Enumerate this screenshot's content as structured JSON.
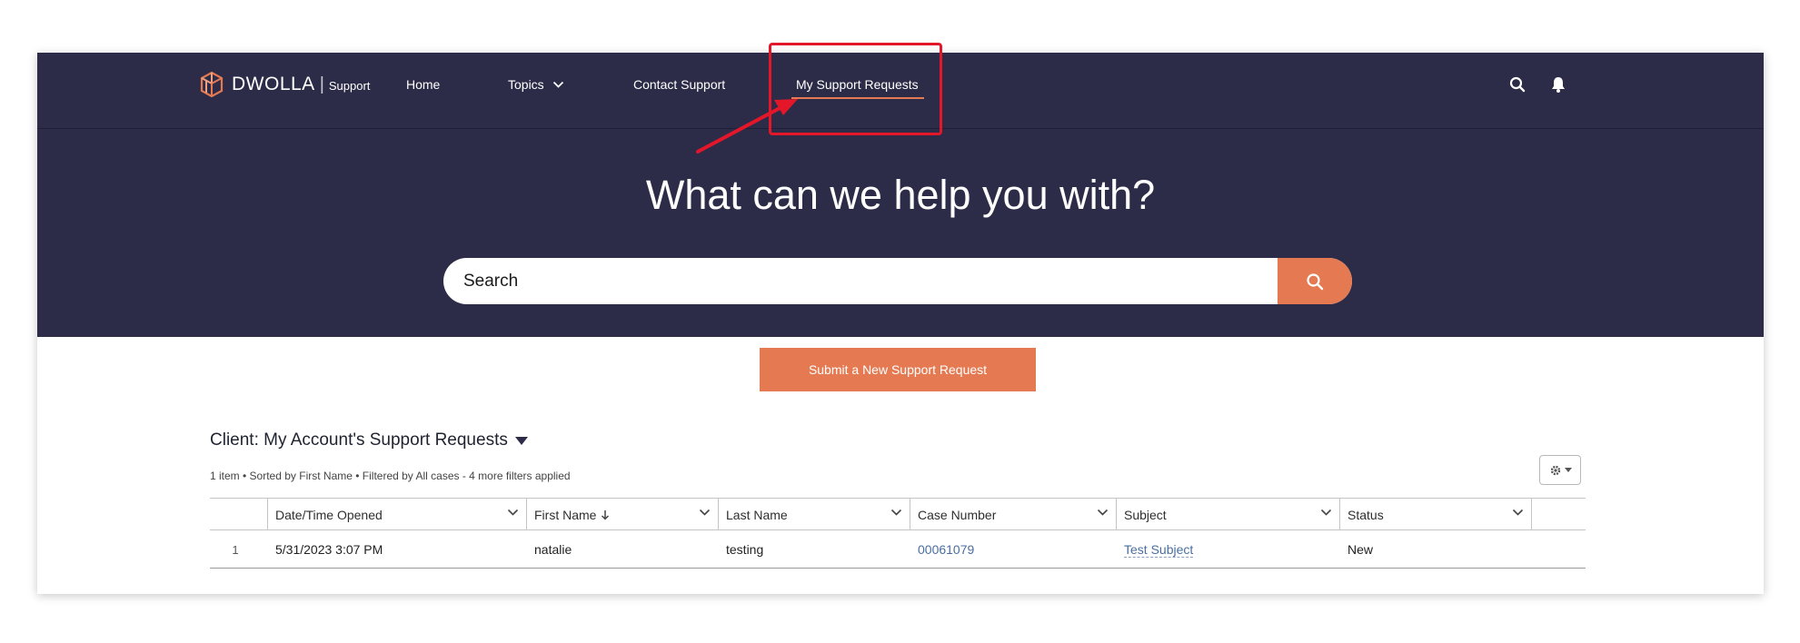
{
  "nav": {
    "logo_word": "DWOLLA",
    "logo_separator": "|",
    "logo_support": "Support",
    "items": [
      {
        "label": "Home"
      },
      {
        "label": "Topics"
      },
      {
        "label": "Contact Support"
      },
      {
        "label": "My Support Requests",
        "active": true
      }
    ]
  },
  "hero": {
    "title": "What can we help you with?",
    "search_placeholder": "Search"
  },
  "submit_button": "Submit a New Support Request",
  "list_view": {
    "title": "Client: My Account's Support Requests",
    "meta": "1 item • Sorted by First Name • Filtered by All cases - 4 more filters applied"
  },
  "table": {
    "columns": [
      "Date/Time Opened",
      "First Name",
      "Last Name",
      "Case Number",
      "Subject",
      "Status"
    ],
    "rows": [
      {
        "num": "1",
        "date_opened": "5/31/2023 3:07 PM",
        "first_name": "natalie",
        "last_name": "testing",
        "case_number": "00061079",
        "subject": "Test Subject",
        "status": "New"
      }
    ]
  },
  "colors": {
    "nav_bg": "#2c2c48",
    "accent": "#e57a52",
    "annotation": "#e3162a",
    "link": "#4a6ea0"
  },
  "icons": [
    "dwolla-logo-icon",
    "chevron-down-icon",
    "search-icon",
    "bell-icon",
    "gear-icon",
    "caret-down-icon",
    "sort-arrow-down-icon"
  ]
}
